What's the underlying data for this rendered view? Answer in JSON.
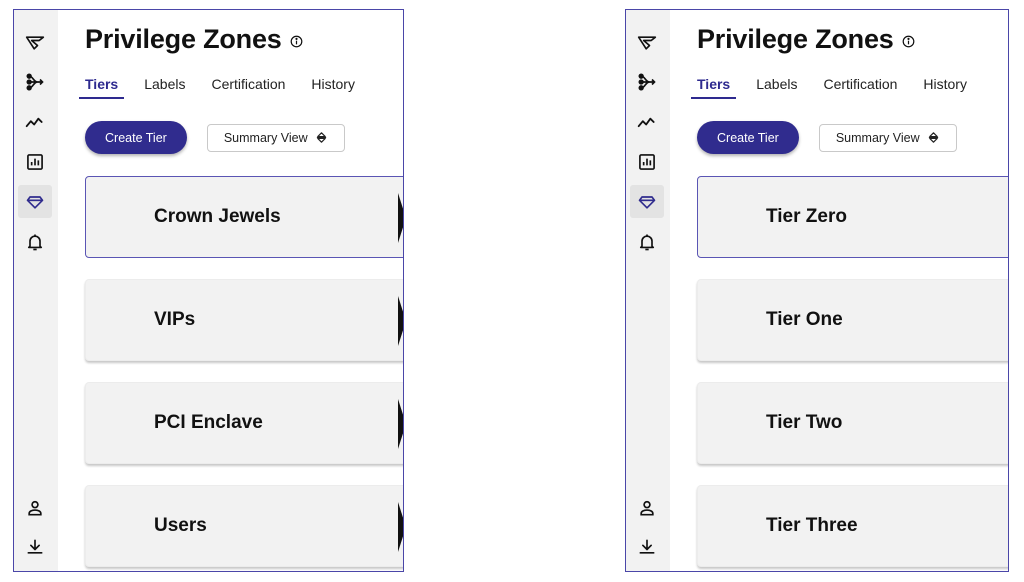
{
  "panels": [
    {
      "title": "Privilege Zones",
      "tabs": [
        {
          "label": "Tiers",
          "active": true
        },
        {
          "label": "Labels",
          "active": false
        },
        {
          "label": "Certification",
          "active": false
        },
        {
          "label": "History",
          "active": false
        }
      ],
      "create_button": "Create Tier",
      "view_button": "Summary View",
      "cards": [
        {
          "label": "Crown Jewels",
          "selected": true
        },
        {
          "label": "VIPs",
          "selected": false
        },
        {
          "label": "PCI Enclave",
          "selected": false
        },
        {
          "label": "Users",
          "selected": false
        }
      ]
    },
    {
      "title": "Privilege Zones",
      "tabs": [
        {
          "label": "Tiers",
          "active": true
        },
        {
          "label": "Labels",
          "active": false
        },
        {
          "label": "Certification",
          "active": false
        },
        {
          "label": "History",
          "active": false
        }
      ],
      "create_button": "Create Tier",
      "view_button": "Summary View",
      "cards": [
        {
          "label": "Tier Zero",
          "selected": true
        },
        {
          "label": "Tier One",
          "selected": false
        },
        {
          "label": "Tier Two",
          "selected": false
        },
        {
          "label": "Tier Three",
          "selected": false
        }
      ]
    }
  ],
  "sidebar_icons": [
    "logo-icon",
    "explore-icon",
    "trend-icon",
    "chart-icon",
    "gem-icon",
    "bell-icon",
    "user-icon",
    "download-icon"
  ],
  "active_sidebar_icon": "gem-icon",
  "colors": {
    "accent": "#302c8e",
    "panel_border": "#4a46a8",
    "rail": "#f2f2f2",
    "card": "#f2f2f2"
  }
}
